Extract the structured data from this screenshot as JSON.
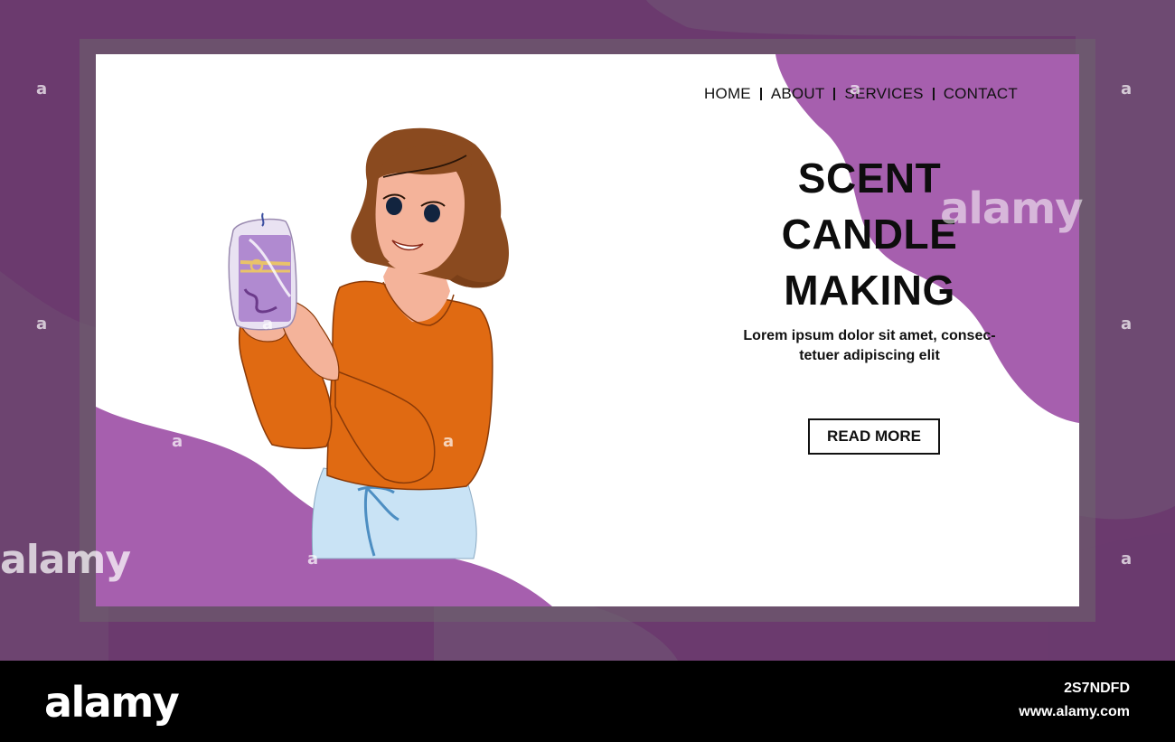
{
  "nav": {
    "items": [
      {
        "label": "HOME"
      },
      {
        "label": "ABOUT"
      },
      {
        "label": "SERVICES"
      },
      {
        "label": "CONTACT"
      }
    ]
  },
  "hero": {
    "title_lines": [
      "SCENT",
      "CANDLE",
      "MAKING"
    ],
    "subtitle_line1": "Lorem ipsum dolor sit amet, consec-",
    "subtitle_line2": "tetuer adipiscing elit",
    "cta_label": "READ MORE"
  },
  "watermarks": {
    "center": "alamy",
    "left": "alamy",
    "small_glyph": "a"
  },
  "footer": {
    "logo": "alamy",
    "image_id": "2S7NDFD",
    "url": "www.alamy.com"
  },
  "colors": {
    "outer_purple": "#6b3a6e",
    "blob_purple": "#a65fae",
    "card_bg": "#ffffff",
    "sweater_orange": "#e06a12",
    "hair_brown": "#8a4a1f",
    "candle_lilac": "#b08ad0"
  }
}
